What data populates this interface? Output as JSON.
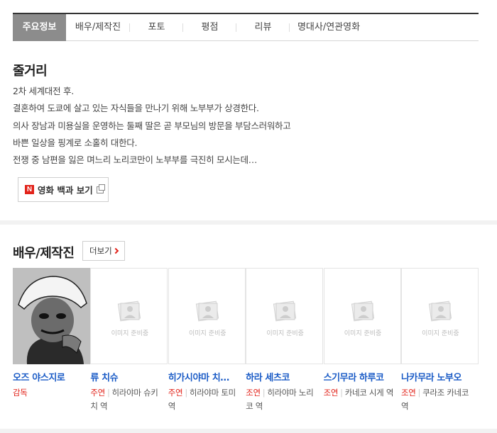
{
  "tabs": [
    {
      "label": "주요정보",
      "active": true
    },
    {
      "label": "배우/제작진",
      "active": false
    },
    {
      "label": "포토",
      "active": false
    },
    {
      "label": "평점",
      "active": false
    },
    {
      "label": "리뷰",
      "active": false
    },
    {
      "label": "명대사/연관영화",
      "active": false
    }
  ],
  "synopsis": {
    "title": "줄거리",
    "lines": [
      "2차 세계대전 후.",
      " 결혼하여 도쿄에 살고 있는 자식들을 만나기 위해 노부부가 상경한다.",
      " 의사 장남과 미용실을 운영하는 둘째 딸은 곧 부모님의 방문을 부담스러워하고",
      " 바쁜 일상을 핑계로 소홀히 대한다.",
      " 전쟁 중 남편을 잃은 며느리 노리코만이 노부부를 극진히 모시는데…"
    ],
    "encyclopedia_button": "영화 백과 보기",
    "naver_logo": "N"
  },
  "cast_section": {
    "title": "배우/제작진",
    "more_label": "더보기",
    "placeholder_text": "이미지 준비중",
    "members": [
      {
        "name": "오즈 야스지로",
        "type": "감독",
        "role": "",
        "has_photo": true
      },
      {
        "name": "류 치슈",
        "type": "주연",
        "role": "히라야마 슈키치 역",
        "has_photo": false
      },
      {
        "name": "히가시야마 치…",
        "type": "주연",
        "role": "히라야마 토미 역",
        "has_photo": false
      },
      {
        "name": "하라 세츠코",
        "type": "조연",
        "role": "히라야마 노리코 역",
        "has_photo": false
      },
      {
        "name": "스기무라 하루코",
        "type": "조연",
        "role": "카네코 시게 역",
        "has_photo": false
      },
      {
        "name": "나카무라 노부오",
        "type": "조연",
        "role": "쿠라조 카네코 역",
        "has_photo": false
      }
    ]
  },
  "colors": {
    "accent_red": "#e2231a",
    "link_blue": "#1a5bc6",
    "active_tab": "#8c8c8c"
  }
}
